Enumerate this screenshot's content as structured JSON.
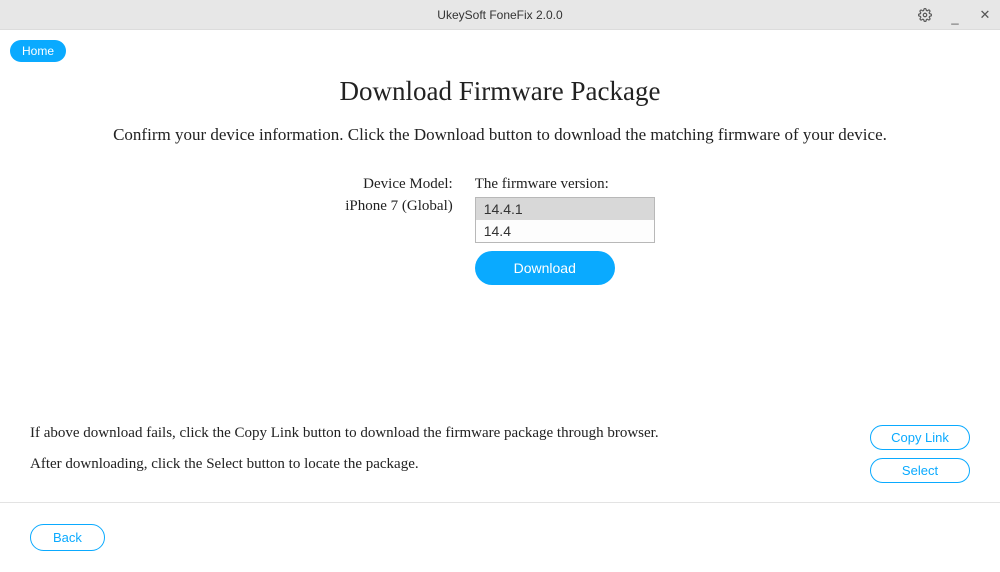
{
  "titlebar": {
    "title": "UkeySoft FoneFix 2.0.0"
  },
  "nav": {
    "home": "Home"
  },
  "main": {
    "title": "Download Firmware Package",
    "subtitle": "Confirm your device information. Click the Download button to download the matching firmware of your device.",
    "device_model_label": "Device Model:",
    "device_model_value": "iPhone 7 (Global)",
    "firmware_version_label": "The firmware version:",
    "firmware_versions": [
      "14.4.1",
      "14.4"
    ],
    "download_label": "Download"
  },
  "help": {
    "line1": "If above download fails, click the Copy Link button to download the firmware package through browser.",
    "line2": "After downloading, click the Select button to locate the package.",
    "copy_link_label": "Copy Link",
    "select_label": "Select"
  },
  "footer": {
    "back_label": "Back"
  }
}
